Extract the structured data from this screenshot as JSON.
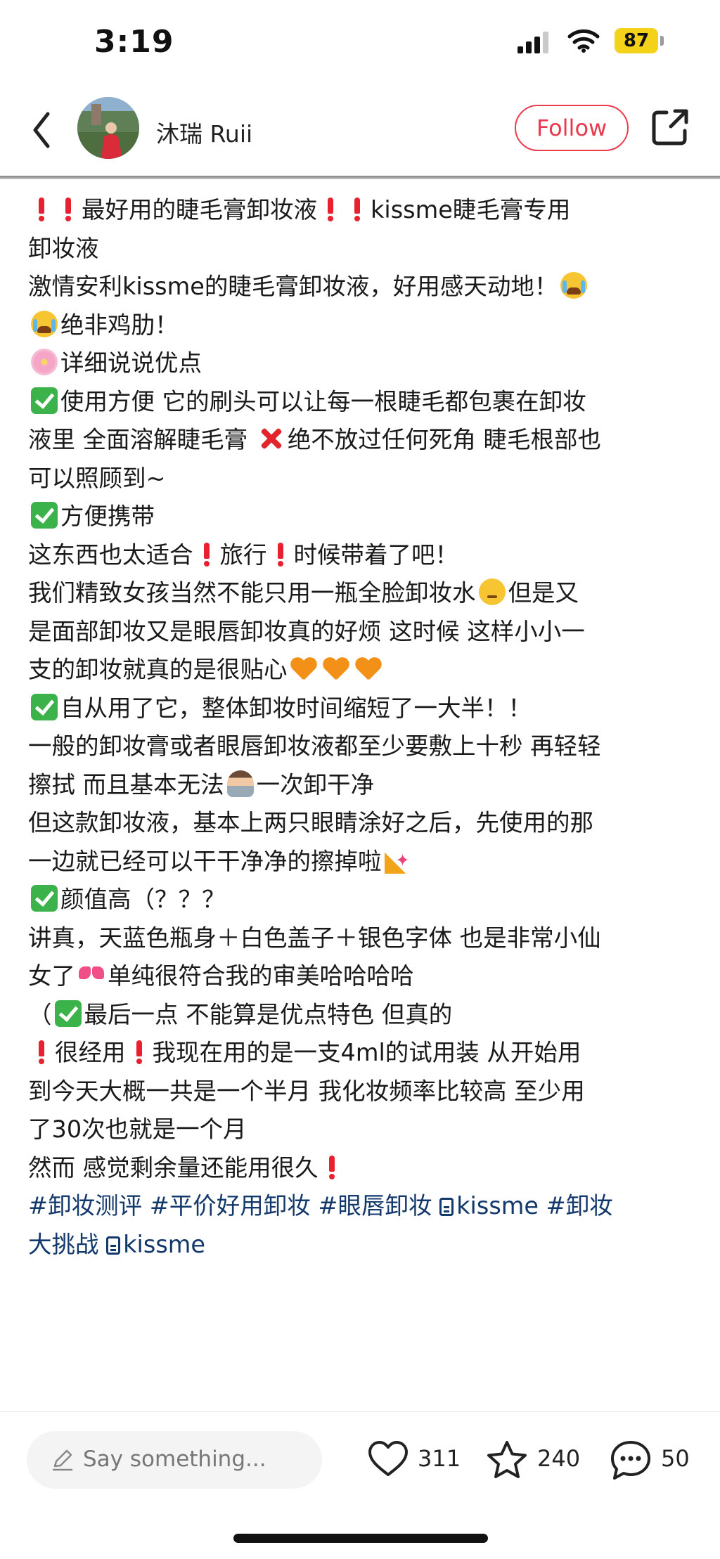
{
  "status_bar": {
    "time": "3:19",
    "battery": "87",
    "battery_color": "#f4d219"
  },
  "header": {
    "author_name": "沐瑞 Ruii",
    "follow_label": "Follow",
    "accent_color": "#ee3a4d"
  },
  "post": {
    "lines": [
      [
        {
          "icon": "red-exclamation"
        },
        {
          "icon": "red-exclamation"
        },
        {
          "t": "最好用的睫毛膏卸妆液"
        },
        {
          "icon": "red-exclamation"
        },
        {
          "icon": "red-exclamation"
        },
        {
          "t": "kissme睫毛膏专用"
        }
      ],
      [
        {
          "t": "卸妆液"
        }
      ],
      [
        {
          "t": "激情安利kissme的睫毛膏卸妆液，好用感天动地！"
        },
        {
          "icon": "crying-face"
        }
      ],
      [
        {
          "icon": "crying-face"
        },
        {
          "t": "绝非鸡肋！"
        }
      ],
      [
        {
          "icon": "cherry-blossom"
        },
        {
          "t": "详细说说优点"
        }
      ],
      [
        {
          "icon": "check-mark"
        },
        {
          "t": "使用方便 它的刷头可以让每一根睫毛都包裹在卸妆"
        }
      ],
      [
        {
          "t": "液里 全面溶解睫毛膏 "
        },
        {
          "icon": "cross-mark"
        },
        {
          "t": "绝不放过任何死角 睫毛根部也"
        }
      ],
      [
        {
          "t": "可以照顾到~"
        }
      ],
      [
        {
          "icon": "check-mark"
        },
        {
          "t": "方便携带"
        }
      ],
      [
        {
          "t": "这东西也太适合"
        },
        {
          "icon": "red-exclamation"
        },
        {
          "t": "旅行"
        },
        {
          "icon": "red-exclamation"
        },
        {
          "t": "时候带着了吧！"
        }
      ],
      [
        {
          "t": "我们精致女孩当然不能只用一瓶全脸卸妆水"
        },
        {
          "icon": "thinking-face"
        },
        {
          "t": "但是又"
        }
      ],
      [
        {
          "t": "是面部卸妆又是眼唇卸妆真的好烦 这时候 这样小小一"
        }
      ],
      [
        {
          "t": "支的卸妆就真的是很贴心"
        },
        {
          "icon": "orange-heart"
        },
        {
          "icon": "orange-heart"
        },
        {
          "icon": "orange-heart"
        }
      ],
      [
        {
          "icon": "check-mark"
        },
        {
          "t": "自从用了它，整体卸妆时间缩短了一大半！！"
        }
      ],
      [
        {
          "t": "一般的卸妆膏或者眼唇卸妆液都至少要敷上十秒 再轻轻"
        }
      ],
      [
        {
          "t": "擦拭 而且基本无法"
        },
        {
          "icon": "person-crossing-arms"
        },
        {
          "t": "一次卸干净"
        }
      ],
      [
        {
          "t": "但这款卸妆液，基本上两只眼睛涂好之后，先使用的那"
        }
      ],
      [
        {
          "t": "一边就已经可以干干净净的擦掉啦"
        },
        {
          "icon": "party-popper"
        }
      ],
      [
        {
          "icon": "check-mark"
        },
        {
          "t": "颜值高（？？？"
        }
      ],
      [
        {
          "t": "讲真，天蓝色瓶身＋白色盖子＋银色字体 也是非常小仙"
        }
      ],
      [
        {
          "t": "女了"
        },
        {
          "icon": "ribbon"
        },
        {
          "t": "单纯很符合我的审美哈哈哈哈"
        }
      ],
      [
        {
          "t": "（"
        },
        {
          "icon": "check-mark"
        },
        {
          "t": "最后一点 不能算是优点特色 但真的"
        }
      ],
      [
        {
          "icon": "red-exclamation"
        },
        {
          "t": "很经用"
        },
        {
          "icon": "red-exclamation"
        },
        {
          "t": "我现在用的是一支4ml的试用装 从开始用"
        }
      ],
      [
        {
          "t": "到今天大概一共是一个半月 我化妆频率比较高 至少用"
        }
      ],
      [
        {
          "t": "了30次也就是一个月"
        }
      ],
      [
        {
          "t": "然而 感觉剩余量还能用很久"
        },
        {
          "icon": "red-exclamation"
        }
      ],
      [
        {
          "t": "#卸妆测评 #平价好用卸妆 #眼唇卸妆 "
        },
        {
          "icon": "topic"
        },
        {
          "t": "kissme #卸妆"
        }
      ],
      [
        {
          "t": "大挑战 "
        },
        {
          "icon": "topic"
        },
        {
          "t": "kissme"
        }
      ]
    ],
    "tag_line_indices": [
      26,
      27
    ],
    "tag_color": "#13386b"
  },
  "bottom_bar": {
    "comment_placeholder": "Say something...",
    "likes": "311",
    "collects": "240",
    "comments": "50"
  }
}
